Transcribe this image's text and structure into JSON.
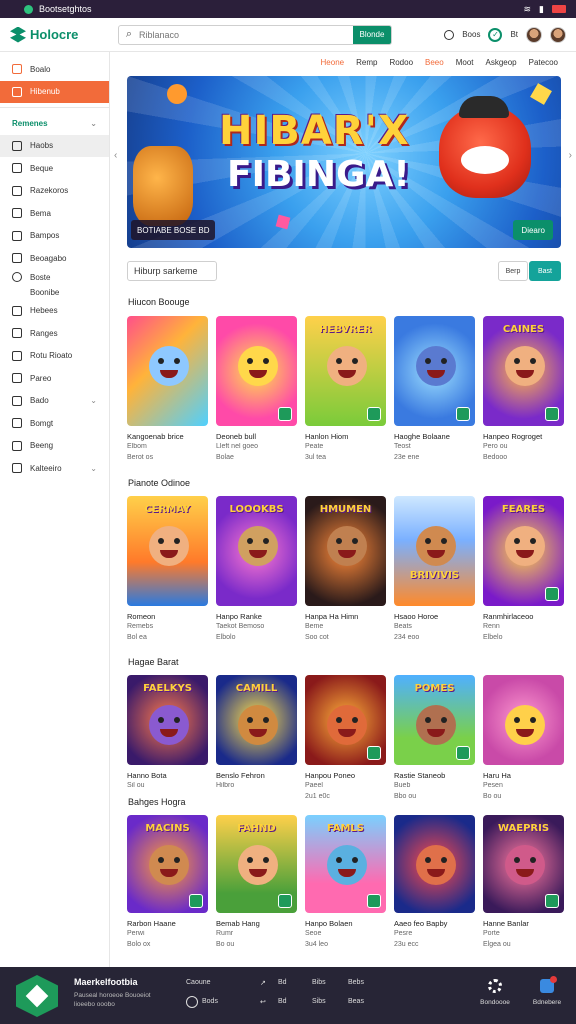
{
  "statusbar": {
    "app_name": "Bootsetghtos"
  },
  "header": {
    "logo": "Holocre",
    "search_placeholder": "Riblanaco",
    "search_button": "Blonde",
    "action_1": "Boos",
    "action_2": "Bt"
  },
  "sidebar": {
    "items": [
      {
        "label": "Boalo"
      },
      {
        "label": "Hibenub"
      },
      {
        "label": "Remenes"
      },
      {
        "label": "Haobs"
      },
      {
        "label": "Beque"
      },
      {
        "label": "Razekoros"
      },
      {
        "label": "Bema"
      },
      {
        "label": "Bampos"
      },
      {
        "label": "Beoagabo"
      },
      {
        "label": "Boste"
      },
      {
        "label": "Boonibe"
      },
      {
        "label": "Hebees"
      },
      {
        "label": "Ranges"
      },
      {
        "label": "Rotu Rioato"
      },
      {
        "label": "Pareo"
      },
      {
        "label": "Bado"
      },
      {
        "label": "Bomgt"
      },
      {
        "label": "Beeng"
      },
      {
        "label": "Kalteeiro"
      }
    ]
  },
  "tabs": [
    "Heone",
    "Remp",
    "Rodoo",
    "Beeo",
    "Moot",
    "Askgeop",
    "Patecoo"
  ],
  "banner": {
    "title_line1": "HIBAR'X",
    "title_line2": "FIBINGA!",
    "tag": "BOTIABE BOSE BD",
    "button": "Diearo"
  },
  "filter": {
    "field": "Hiburp sarkeme",
    "btn1": "Berp",
    "btn2": "Bast"
  },
  "sections": [
    {
      "title": "Hiucon Boouge",
      "cards": [
        {
          "art": "",
          "name": "Kangoenab brice",
          "sub": "Elbom",
          "meta": "Berot os"
        },
        {
          "art": "",
          "name": "Deoneb bull",
          "sub": "Lleft nel goeo",
          "meta": "Bolae"
        },
        {
          "art": "HEBVRER",
          "name": "Hanlon Hiom",
          "sub": "Peate",
          "meta": "3ul tea"
        },
        {
          "art": "",
          "name": "Haoghe Bolaane",
          "sub": "Teost",
          "meta": "23e ene"
        },
        {
          "art": "CAINES",
          "name": "Hanpeo Rogroget",
          "sub": "Pero ou",
          "meta": "Bedooo"
        }
      ]
    },
    {
      "title": "Pianote Odinoe",
      "cards": [
        {
          "art": "CERMAY",
          "name": "Romeon",
          "sub": "Remebs",
          "meta": "Bol ea"
        },
        {
          "art": "LOOOKBS",
          "name": "Hanpo Ranke",
          "sub": "Taekot Bemoso",
          "meta": "Elbolo"
        },
        {
          "art": "HMUMEN",
          "name": "Hanpa Ha Himn",
          "sub": "Beme",
          "meta": "Soo cot"
        },
        {
          "art": "BRIVIVIS",
          "name": "Hsaoo Horoe",
          "sub": "Beats",
          "meta": "234 eoo"
        },
        {
          "art": "FEARES",
          "name": "Ranmhirlaceoo",
          "sub": "Renn",
          "meta": "Elbelo"
        }
      ]
    },
    {
      "title": "Hagae Barat",
      "cards": [
        {
          "art": "FAELKYS",
          "name": "Hanno Bota",
          "sub": "Sil ou",
          "meta": ""
        },
        {
          "art": "CAMILL",
          "name": "Benslo Fehron",
          "sub": "Hilbro",
          "meta": ""
        },
        {
          "art": "",
          "name": "Hanpou Poneo",
          "sub": "Paeel",
          "meta": "2u1 e0c"
        },
        {
          "art": "POMES",
          "name": "Rastie Staneob",
          "sub": "Bueb",
          "meta": "Bbo ou"
        },
        {
          "art": "",
          "name": "Haru Ha",
          "sub": "Pesen",
          "meta": "Bo ou"
        }
      ]
    },
    {
      "title": "Bahges Hogra",
      "cards": [
        {
          "art": "MACINS",
          "name": "Rarbon Haane",
          "sub": "Perwi",
          "meta": "Bolo ox"
        },
        {
          "art": "FAHND",
          "name": "Bemab Hang",
          "sub": "Rumr",
          "meta": "Bo ou"
        },
        {
          "art": "FAMLS",
          "name": "Hanpo Bolaen",
          "sub": "Seoe",
          "meta": "3u4 leo"
        },
        {
          "art": "",
          "name": "Aaeo feo Bapby",
          "sub": "Pesre",
          "meta": "23u ecc"
        },
        {
          "art": "WAEPRIS",
          "name": "Hanne Banlar",
          "sub": "Porte",
          "meta": "Elgea ou"
        }
      ]
    }
  ],
  "footer": {
    "title": "Maerkelfootbia",
    "desc": "Pauseal horoeoe Bouoeiot lioeebo ooobo",
    "col1": [
      "Caoune",
      "Bods"
    ],
    "col2": [
      "Bd",
      "Bd"
    ],
    "col3": [
      "Bibs",
      "Sibs"
    ],
    "col4": [
      "Bebs",
      "Beas"
    ],
    "right1": "Bondoooe",
    "right2": "Bdnebere"
  }
}
